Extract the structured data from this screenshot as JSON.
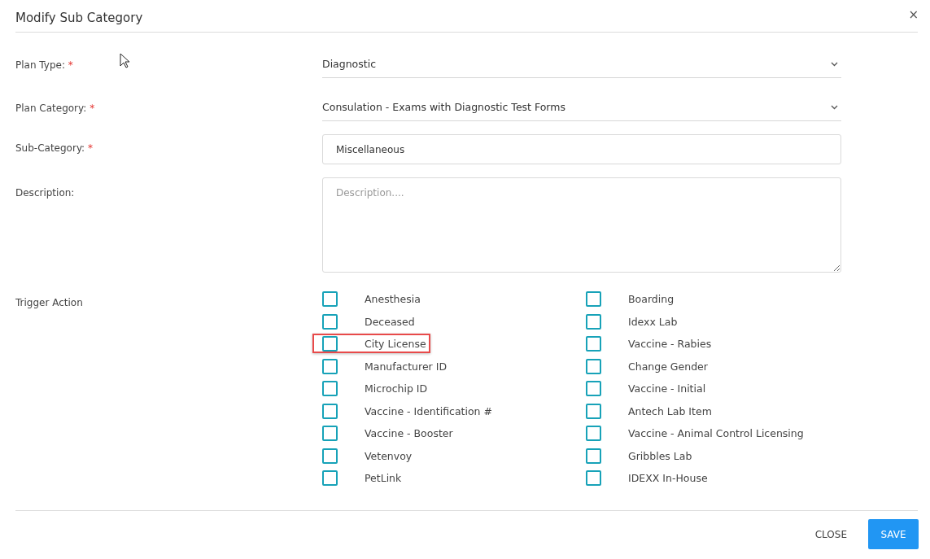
{
  "dialog": {
    "title": "Modify Sub Category",
    "close_icon": "×"
  },
  "fields": [
    {
      "kind": "select",
      "label": "Plan Type:",
      "required_mark": "*",
      "value": "Diagnostic"
    },
    {
      "kind": "select",
      "label": "Plan Category:",
      "required_mark": "*",
      "value": "Consulation - Exams with Diagnostic Test Forms"
    },
    {
      "kind": "input",
      "label": "Sub-Category:",
      "required_mark": "*",
      "value": "Miscellaneous"
    },
    {
      "kind": "textarea",
      "label": "Description:",
      "placeholder": "Description...."
    }
  ],
  "trigger_action": {
    "label": "Trigger Action",
    "options": [
      {
        "label": "Anesthesia",
        "checked": false,
        "highlighted": false
      },
      {
        "label": "Boarding",
        "checked": false,
        "highlighted": false
      },
      {
        "label": "Deceased",
        "checked": false,
        "highlighted": false
      },
      {
        "label": "Idexx Lab",
        "checked": false,
        "highlighted": false
      },
      {
        "label": "City License",
        "checked": false,
        "highlighted": true
      },
      {
        "label": "Vaccine - Rabies",
        "checked": false,
        "highlighted": false
      },
      {
        "label": "Manufacturer ID",
        "checked": false,
        "highlighted": false
      },
      {
        "label": "Change Gender",
        "checked": false,
        "highlighted": false
      },
      {
        "label": "Microchip ID",
        "checked": false,
        "highlighted": false
      },
      {
        "label": "Vaccine - Initial",
        "checked": false,
        "highlighted": false
      },
      {
        "label": "Vaccine - Identification #",
        "checked": false,
        "highlighted": false
      },
      {
        "label": "Antech Lab Item",
        "checked": false,
        "highlighted": false
      },
      {
        "label": "Vaccine - Booster",
        "checked": false,
        "highlighted": false
      },
      {
        "label": "Vaccine - Animal Control Licensing",
        "checked": false,
        "highlighted": false
      },
      {
        "label": "Vetenvoy",
        "checked": false,
        "highlighted": false
      },
      {
        "label": "Gribbles Lab",
        "checked": false,
        "highlighted": false
      },
      {
        "label": "PetLink",
        "checked": false,
        "highlighted": false
      },
      {
        "label": "IDEXX In-House",
        "checked": false,
        "highlighted": false
      }
    ]
  },
  "buttons": [
    {
      "kind": "text",
      "label": "CLOSE"
    },
    {
      "kind": "primary",
      "label": "SAVE"
    }
  ]
}
